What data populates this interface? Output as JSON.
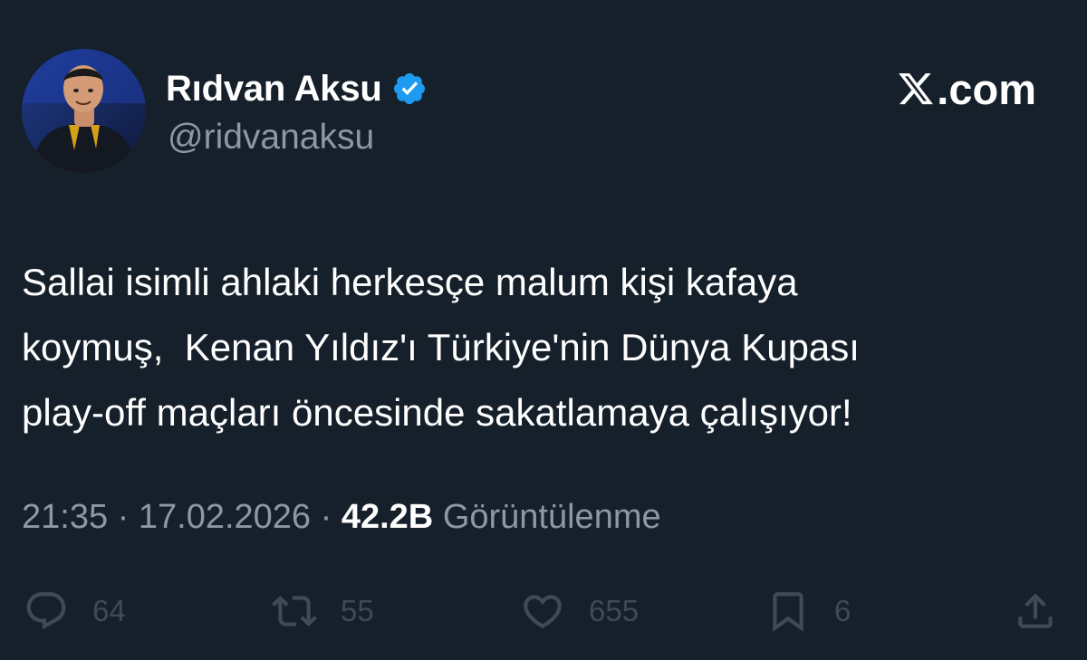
{
  "user": {
    "display_name": "Rıdvan Aksu",
    "handle": "@ridvanaksu",
    "verified": true,
    "verified_icon": "verified-badge-icon",
    "avatar_icon": "profile-photo"
  },
  "brand": {
    "logo_icon": "x-logo-icon",
    "text": ".com"
  },
  "tweet": {
    "text": "Sallai isimli ahlaki herkesçe malum kişi kafaya\nkoymuş,  Kenan Yıldız'ı Türkiye'nin Dünya Kupası\nplay-off maçları öncesinde sakatlamaya çalışıyor!",
    "time": "21:35",
    "separator": " · ",
    "date": "17.02.2026",
    "views_count": "42.2B",
    "views_label": "Görüntülenme"
  },
  "actions": {
    "reply": {
      "icon": "reply-icon",
      "count": "64"
    },
    "retweet": {
      "icon": "retweet-icon",
      "count": "55"
    },
    "like": {
      "icon": "heart-icon",
      "count": "655"
    },
    "bookmark": {
      "icon": "bookmark-icon",
      "count": "6"
    },
    "share": {
      "icon": "share-icon"
    }
  },
  "colors": {
    "background": "#15202b",
    "text_primary": "#ffffff",
    "text_secondary": "#8b98a5",
    "action_icons": "#3e4a56",
    "verified_blue": "#1d9bf0"
  }
}
